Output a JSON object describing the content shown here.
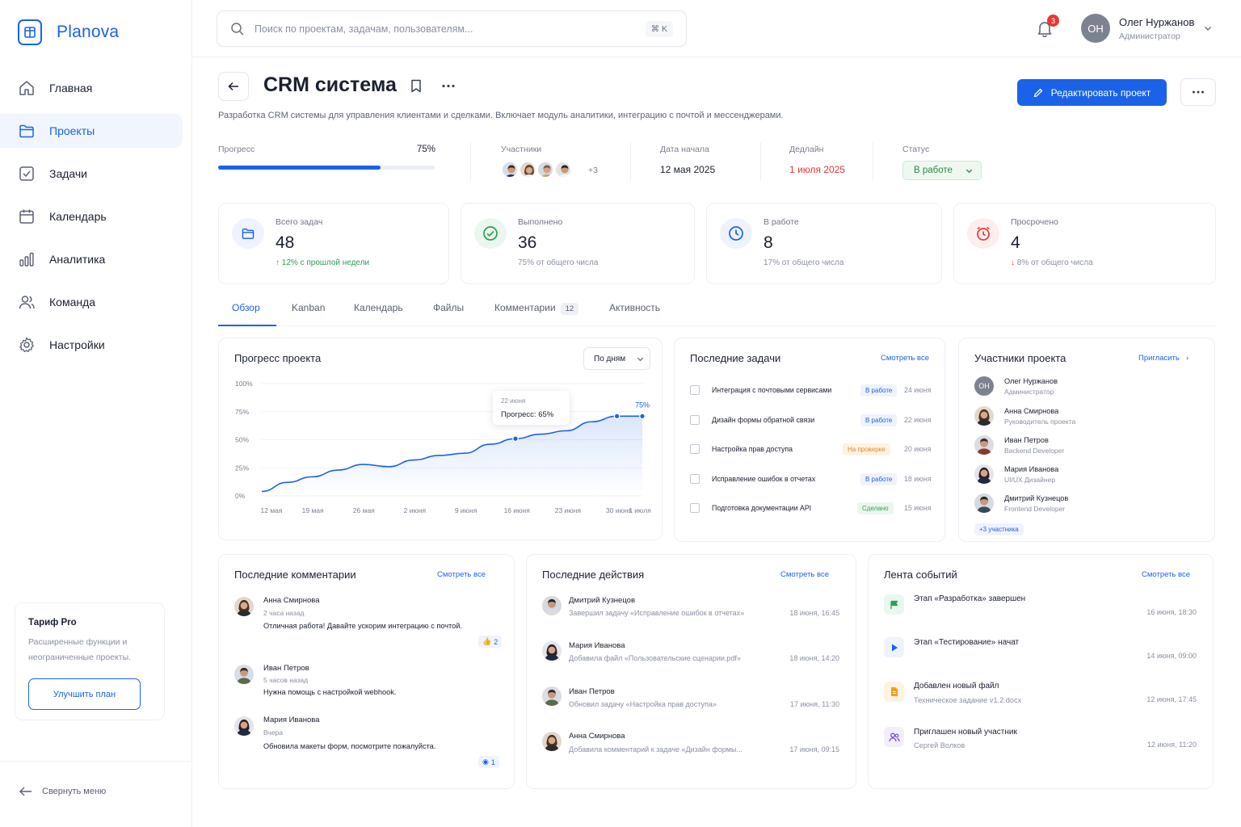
{
  "app": {
    "name": "Planova"
  },
  "sidebar": {
    "items": [
      {
        "label": "Главная",
        "icon": "home-icon"
      },
      {
        "label": "Проекты",
        "icon": "folder-icon",
        "active": true
      },
      {
        "label": "Задачи",
        "icon": "checkbox-icon"
      },
      {
        "label": "Календарь",
        "icon": "calendar-icon"
      },
      {
        "label": "Аналитика",
        "icon": "bar-chart-icon"
      },
      {
        "label": "Команда",
        "icon": "team-icon"
      },
      {
        "label": "Настройки",
        "icon": "gear-icon"
      }
    ],
    "plan": {
      "title": "Тариф Pro",
      "desc_line1": "Расширенные функции и",
      "desc_line2": "неограниченные проекты.",
      "button": "Улучшить план"
    },
    "collapse": "Свернуть меню"
  },
  "header": {
    "search_placeholder": "Поиск по проектам, задачам, пользователям...",
    "search_shortcut": "⌘ K",
    "notifications": "3",
    "user": {
      "initials": "ОН",
      "name": "Олег Нуржанов",
      "role": "Администратор"
    }
  },
  "project": {
    "title": "CRM система",
    "description": "Разработка CRM системы для управления клиентами и сделками. Включает модуль аналитики, интеграцию с почтой и мессенджерами.",
    "edit_button": "Редактировать проект",
    "progress_label": "Прогресс",
    "progress_value": "75%",
    "progress_fraction": 0.75,
    "members_label": "Участники",
    "members_more": "+3",
    "start_label": "Дата начала",
    "start_value": "12 мая 2025",
    "deadline_label": "Дедлайн",
    "deadline_value": "1 июля 2025",
    "status_label": "Статус",
    "status_value": "В работе"
  },
  "stats": [
    {
      "label": "Всего задач",
      "value": "48",
      "sub": "12% с прошлой недели",
      "trend": "up",
      "color": "#1a63e8"
    },
    {
      "label": "Выполнено",
      "value": "36",
      "sub": "75% от общего числа",
      "trend": "none",
      "color": "#2e9e52"
    },
    {
      "label": "В работе",
      "value": "8",
      "sub": "17% от общего числа",
      "trend": "none",
      "color": "#1a63e8"
    },
    {
      "label": "Просрочено",
      "value": "4",
      "sub": "8% от общего числа",
      "trend": "down",
      "color": "#e53935"
    }
  ],
  "tabs": [
    {
      "label": "Обзор",
      "active": true
    },
    {
      "label": "Kanban"
    },
    {
      "label": "Календарь"
    },
    {
      "label": "Файлы"
    },
    {
      "label": "Комментарии",
      "count": "12"
    },
    {
      "label": "Активность"
    }
  ],
  "progress_panel": {
    "title": "Прогресс проекта",
    "period": "По дням",
    "tooltip_date": "22 июня",
    "tooltip_value": "Прогресс: 65%",
    "end_label": "75%"
  },
  "chart_data": {
    "type": "area",
    "title": "Прогресс проекта",
    "x_ticks": [
      "12 мая",
      "19 мая",
      "26 мая",
      "2 июня",
      "9 июня",
      "16 июня",
      "23 июня",
      "30 июня",
      "1 июля"
    ],
    "y_ticks": [
      "0%",
      "25%",
      "50%",
      "75%",
      "100%"
    ],
    "ylim": [
      0,
      100
    ],
    "series": [
      {
        "x": [
          "12 мая",
          "16 мая",
          "19 мая",
          "23 мая",
          "26 мая",
          "30 мая",
          "2 июня",
          "6 июня",
          "9 июня",
          "13 июня",
          "16 июня",
          "20 июня",
          "23 июня",
          "27 июня",
          "30 июня",
          "1 июля"
        ],
        "values": [
          4,
          12,
          17,
          23,
          28,
          26,
          32,
          36,
          38,
          46,
          51,
          55,
          58,
          66,
          71,
          71
        ],
        "highlight_points": [
          10,
          14,
          15
        ]
      }
    ]
  },
  "tasks_panel": {
    "title": "Последние задачи",
    "link": "Смотреть все",
    "rows": [
      {
        "name": "Интеграция с почтовыми сервисами",
        "status": "В работе",
        "date": "24 июня",
        "bg": "#eef3fd",
        "fg": "#1a63e8"
      },
      {
        "name": "Дизайн формы обратной связи",
        "status": "В работе",
        "date": "22 июня",
        "bg": "#eef3fd",
        "fg": "#1a63e8"
      },
      {
        "name": "Настройка прав доступа",
        "status": "На проверке",
        "date": "20 июня",
        "bg": "#fdf3e3",
        "fg": "#e08a18"
      },
      {
        "name": "Исправление ошибок в отчетах",
        "status": "В работе",
        "date": "18 июня",
        "bg": "#eef3fd",
        "fg": "#1a63e8"
      },
      {
        "name": "Подготовка документации API",
        "status": "Сделано",
        "date": "15 июня",
        "bg": "#eaf7ee",
        "fg": "#2e9e52"
      }
    ]
  },
  "members_panel": {
    "title": "Участники проекта",
    "link": "Пригласить",
    "members": [
      {
        "name": "Олег Нуржанов",
        "role": "Администратор",
        "initials": "ОН"
      },
      {
        "name": "Анна Смирнова",
        "role": "Руководитель проекта"
      },
      {
        "name": "Иван Петров",
        "role": "Backend Developer"
      },
      {
        "name": "Мария Иванова",
        "role": "UI/UX Дизайнер"
      },
      {
        "name": "Дмитрий Кузнецов",
        "role": "Frontend Developer"
      }
    ],
    "more": "+3 участника"
  },
  "comments_panel": {
    "title": "Последние комментарии",
    "link": "Смотреть все",
    "items": [
      {
        "name": "Анна Смирнова",
        "time": "2 часа назад",
        "text": "Отличная работа! Давайте ускорим интеграцию с почтой.",
        "likes": "2"
      },
      {
        "name": "Иван Петров",
        "time": "5 часов назад",
        "text": "Нужна помощь с настройкой webhook."
      },
      {
        "name": "Мария Иванова",
        "time": "Вчера",
        "text": "Обновила макеты форм, посмотрите пожалуйста.",
        "views": "1"
      }
    ]
  },
  "actions_panel": {
    "title": "Последние действия",
    "link": "Смотреть все",
    "items": [
      {
        "name": "Дмитрий Кузнецов",
        "text": "Завершил задачу «Исправление ошибок в отчетах»",
        "time": "18 июня, 16:45"
      },
      {
        "name": "Мария Иванова",
        "text": "Добавила файл «Пользовательские сценарии.pdf»",
        "time": "18 июня, 14:20"
      },
      {
        "name": "Иван Петров",
        "text": "Обновил задачу «Настройка прав доступа»",
        "time": "17 июня, 11:30"
      },
      {
        "name": "Анна Смирнова",
        "text": "Добавила комментарий к задаче «Дизайн формы...",
        "time": "17 июня, 09:15"
      }
    ]
  },
  "events_panel": {
    "title": "Лента событий",
    "link": "Смотреть все",
    "items": [
      {
        "title": "Этап «Разработка» завершен",
        "sub": "",
        "time": "16 июня, 18:30",
        "icon": "flag-icon",
        "bg": "#eaf7ee",
        "fg": "#2e9e52"
      },
      {
        "title": "Этап «Тестирование» начат",
        "sub": "",
        "time": "14 июня, 09:00",
        "icon": "play-icon",
        "bg": "#eef3fd",
        "fg": "#1a63e8"
      },
      {
        "title": "Добавлен новый файл",
        "sub": "Техническое задание v1.2.docx",
        "time": "12 июня, 17:45",
        "icon": "file-icon",
        "bg": "#fdf3e3",
        "fg": "#f0a020"
      },
      {
        "title": "Приглашен новый участник",
        "sub": "Сергей Волков",
        "time": "12 июня, 11:20",
        "icon": "user-add-icon",
        "bg": "#f3eefd",
        "fg": "#7c4ddb"
      }
    ]
  }
}
